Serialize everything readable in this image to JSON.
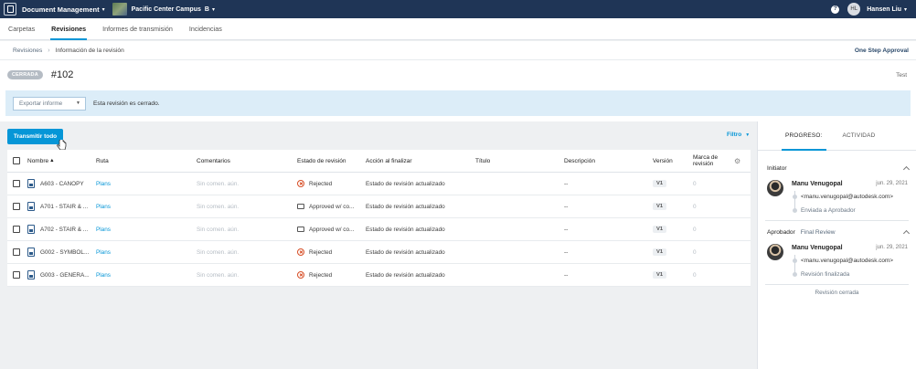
{
  "topbar": {
    "module": "Document Management",
    "project": "Pacific Center Campus",
    "project_badge": "B",
    "help": "?",
    "user_initials": "HL",
    "user_name": "Hansen Liu"
  },
  "tabs": [
    "Carpetas",
    "Revisiones",
    "Informes de transmisión",
    "Incidencias"
  ],
  "active_tab": "Revisiones",
  "breadcrumb": {
    "parent": "Revisiones",
    "current": "Información de la revisión"
  },
  "approval_workflow": "One Step Approval",
  "revision": {
    "status_badge": "CERRADA",
    "number": "#102",
    "name": "Test"
  },
  "banner": {
    "export_placeholder": "Exportar informe",
    "message": "Esta revisión es cerrado."
  },
  "actions": {
    "transmit_all": "Transmitir todo",
    "filter": "Filtro"
  },
  "table": {
    "headers": {
      "name": "Nombre",
      "route": "Ruta",
      "comments": "Comentarios",
      "state": "Estado de revisión",
      "action": "Acción al finalizar",
      "title": "Título",
      "description": "Descripción",
      "version": "Versión",
      "mark": "Marca de revisión"
    },
    "rows": [
      {
        "name": "A603 - CANOPY",
        "route": "Plans",
        "comments": "Sin comen. aún.",
        "state": "Rejected",
        "state_icon": "rejected-icon",
        "action": "Estado de revisión actualizado",
        "description": "--",
        "version": "V1",
        "mark": "0"
      },
      {
        "name": "A701 - STAIR & ...",
        "route": "Plans",
        "comments": "Sin comen. aún.",
        "state": "Approved w/ co...",
        "state_icon": "comment-icon",
        "action": "Estado de revisión actualizado",
        "description": "--",
        "version": "V1",
        "mark": "0"
      },
      {
        "name": "A702 - STAIR & ...",
        "route": "Plans",
        "comments": "Sin comen. aún.",
        "state": "Approved w/ co...",
        "state_icon": "comment-icon",
        "action": "Estado de revisión actualizado",
        "description": "--",
        "version": "V1",
        "mark": "0"
      },
      {
        "name": "G002 - SYMBOL...",
        "route": "Plans",
        "comments": "Sin comen. aún.",
        "state": "Rejected",
        "state_icon": "rejected-icon",
        "action": "Estado de revisión actualizado",
        "description": "--",
        "version": "V1",
        "mark": "0"
      },
      {
        "name": "G003 - GENERA...",
        "route": "Plans",
        "comments": "Sin comen. aún.",
        "state": "Rejected",
        "state_icon": "rejected-icon",
        "action": "Estado de revisión actualizado",
        "description": "--",
        "version": "V1",
        "mark": "0"
      }
    ]
  },
  "panel": {
    "tabs": [
      "PROGRESO:",
      "ACTIVIDAD"
    ],
    "initiator": {
      "heading": "Initiator",
      "name": "Manu Venugopal",
      "date": "jun. 29, 2021",
      "email": "<manu.venugopal@autodesk.com>",
      "status": "Enviada a Aprobador"
    },
    "approver": {
      "heading": "Aprobador",
      "step": "Final Review",
      "name": "Manu Venugopal",
      "date": "jun. 29, 2021",
      "email": "<manu.venugopal@autodesk.com>",
      "status": "Revisión finalizada"
    },
    "closed": "Revisión cerrada"
  },
  "colors": {
    "topbar": "#1f3556",
    "accent": "#0696d7",
    "rejected": "#d74e26"
  }
}
